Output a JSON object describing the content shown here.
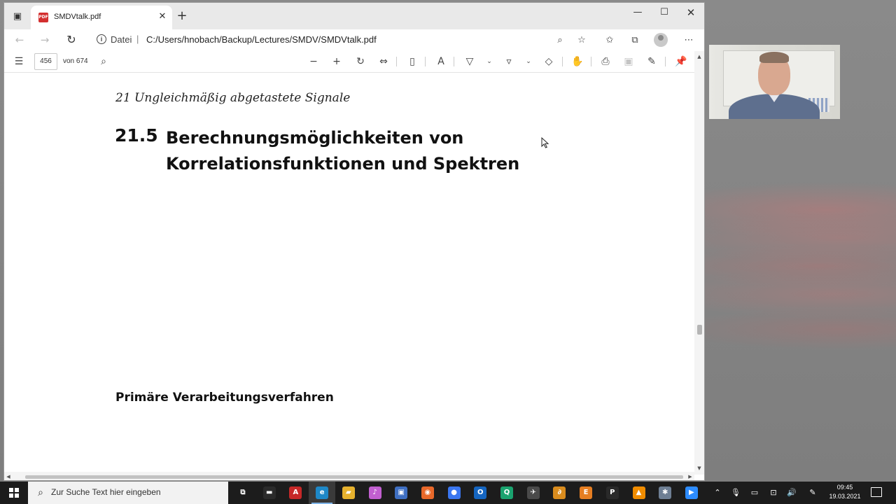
{
  "browser": {
    "tab_title": "SMDVtalk.pdf",
    "new_tab_symbol": "+",
    "address": {
      "scheme_label": "Datei",
      "separator": "|",
      "path": "C:/Users/hnobach/Backup/Lectures/SMDV/SMDVtalk.pdf"
    }
  },
  "pdf_toolbar": {
    "current_page": "456",
    "page_count_label": "von 674"
  },
  "pdf_page": {
    "running_head": "21  Ungleichmäßig abgetastete Signale",
    "section_number": "21.5",
    "section_title_line1": "Berechnungsmöglichkeiten von",
    "section_title_line2": "Korrelationsfunktionen und Spektren",
    "subsection_title": "Primäre Verarbeitungsverfahren"
  },
  "taskbar": {
    "search_placeholder": "Zur Suche Text hier eingeben",
    "apps": [
      {
        "name": "task-view",
        "glyph": "⧉",
        "color": "#1c1c1c"
      },
      {
        "name": "terminal",
        "glyph": "▬",
        "color": "#2b2b2b"
      },
      {
        "name": "acrobat",
        "glyph": "A",
        "color": "#c62828"
      },
      {
        "name": "edge",
        "glyph": "e",
        "color": "#1e88c7"
      },
      {
        "name": "file-explorer",
        "glyph": "▰",
        "color": "#e6b12e"
      },
      {
        "name": "itunes",
        "glyph": "♪",
        "color": "#c15fd0"
      },
      {
        "name": "save-app",
        "glyph": "▣",
        "color": "#3f6fc2"
      },
      {
        "name": "firefox",
        "glyph": "◉",
        "color": "#e8682a"
      },
      {
        "name": "signal",
        "glyph": "●",
        "color": "#3a76f0"
      },
      {
        "name": "outlook",
        "glyph": "O",
        "color": "#1565c0"
      },
      {
        "name": "green-app",
        "glyph": "Q",
        "color": "#1aa36f"
      },
      {
        "name": "tool-app",
        "glyph": "✈",
        "color": "#4a4a4a"
      },
      {
        "name": "link-app",
        "glyph": "∂",
        "color": "#d98c1e"
      },
      {
        "name": "e-app",
        "glyph": "E",
        "color": "#e67e22"
      },
      {
        "name": "p-app",
        "glyph": "P",
        "color": "#2a2a2a"
      },
      {
        "name": "vlc",
        "glyph": "▲",
        "color": "#f08c00"
      },
      {
        "name": "gear-app",
        "glyph": "✱",
        "color": "#6e7f94"
      },
      {
        "name": "zoom",
        "glyph": "▶",
        "color": "#2d8cff"
      }
    ],
    "clock_time": "09:45",
    "clock_date": "19.03.2021"
  },
  "colors": {
    "accent": "#7fb5e8",
    "pdf_icon": "#d32f2f"
  }
}
